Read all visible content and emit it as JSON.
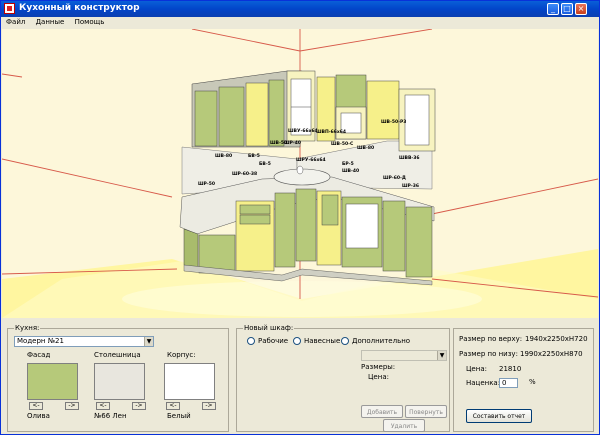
{
  "window": {
    "title": "Кухонный конструктор"
  },
  "menu": [
    "Файл",
    "Данные",
    "Помощь"
  ],
  "scene": {
    "labels": [
      "ШВ-80",
      "БВ-5",
      "ШВУ-66х64",
      "ШВ-50",
      "ШВ-50-С",
      "ШВ-50-Р3",
      "ШВП-66х64",
      "ШВВ-36",
      "ШВ-80",
      "БВ-5",
      "ШРУ-66х64",
      "БР-5",
      "ШВ-40",
      "ШР-60-Д",
      "ШР-36",
      "ШР-50",
      "ШР-60-38",
      "ШР-40"
    ]
  },
  "kitchen": {
    "label": "Кухня:",
    "value": "Модерн №21",
    "facade": {
      "label": "Фасад",
      "value": "Олива",
      "color": "#b6c97a"
    },
    "countertop": {
      "label": "Столешница",
      "value": "№66 Лен",
      "color": "#e8e6de"
    },
    "body": {
      "label": "Корпус:",
      "value": "Белый",
      "color": "#ffffff"
    },
    "prev": "<-",
    "next": "->"
  },
  "new_cabinet": {
    "label": "Новый шкаф:",
    "options": [
      "Рабочие",
      "Навесные",
      "Дополнительно"
    ],
    "select_value": "",
    "sizes_label": "Размеры:",
    "price_label": "Цена:",
    "add": "Добавить",
    "rotate": "Повернуть",
    "delete": "Удалить"
  },
  "summary": {
    "top_label": "Размер по верху:",
    "top_value": "1940х2250хН720",
    "bottom_label": "Размер по низу:",
    "bottom_value": "1990х2250хН870",
    "price_label": "Цена:",
    "price_value": "21810",
    "markup_label": "Наценка:",
    "markup_value": "0",
    "markup_unit": "%",
    "report": "Составить отчет"
  },
  "colors": {
    "wall": "#fdf7da",
    "floor": "#fff8a8",
    "facade_olive": "#b6c97a",
    "facade_yellow": "#f6f08a",
    "wall_line": "#d75a4a"
  }
}
